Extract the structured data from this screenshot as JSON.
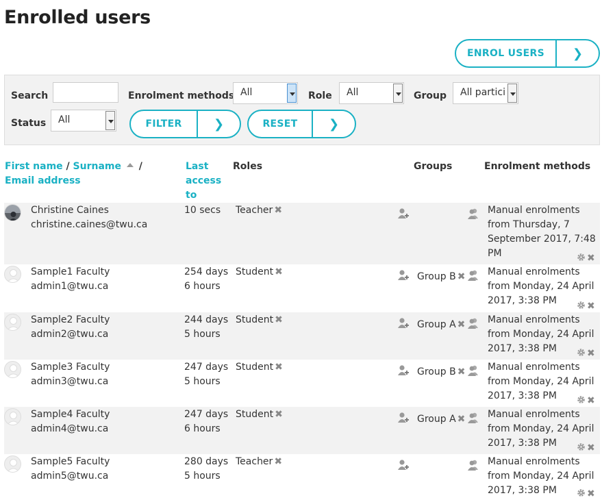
{
  "page": {
    "title": "Enrolled users"
  },
  "actions": {
    "enrol_users": "ENROL USERS"
  },
  "filters": {
    "search_label": "Search",
    "search_value": "",
    "enrolment_methods_label": "Enrolment methods",
    "enrolment_methods_value": "All",
    "role_label": "Role",
    "role_value": "All",
    "group_label": "Group",
    "group_value": "All partici",
    "status_label": "Status",
    "status_value": "All",
    "filter_button": "FILTER",
    "reset_button": "RESET"
  },
  "table": {
    "headers": {
      "first_name": "First name",
      "sep1": " / ",
      "surname": "Surname",
      "sep2": " / ",
      "email": "Email address",
      "last_access": "Last access to course",
      "roles": "Roles",
      "groups": "Groups",
      "enrolment_methods": "Enrolment methods"
    },
    "rows": [
      {
        "name": "Christine Caines",
        "email": "christine.caines@twu.ca",
        "access1": "10 secs",
        "access2": "",
        "role": "Teacher",
        "group": "",
        "enrol1": "Manual enrolments",
        "enrol2": "from Thursday, 7",
        "enrol3": "September 2017, 7:48",
        "enrol4": "PM"
      },
      {
        "name": "Sample1 Faculty",
        "email": "admin1@twu.ca",
        "access1": "254 days",
        "access2": "6 hours",
        "role": "Student",
        "group": "Group B",
        "enrol1": "Manual enrolments",
        "enrol2": "from Monday, 24 April",
        "enrol3": "2017, 3:38 PM",
        "enrol4": ""
      },
      {
        "name": "Sample2 Faculty",
        "email": "admin2@twu.ca",
        "access1": "244 days",
        "access2": "5 hours",
        "role": "Student",
        "group": "Group A",
        "enrol1": "Manual enrolments",
        "enrol2": "from Monday, 24 April",
        "enrol3": "2017, 3:38 PM",
        "enrol4": ""
      },
      {
        "name": "Sample3 Faculty",
        "email": "admin3@twu.ca",
        "access1": "247 days",
        "access2": "5 hours",
        "role": "Student",
        "group": "Group B",
        "enrol1": "Manual enrolments",
        "enrol2": "from Monday, 24 April",
        "enrol3": "2017, 3:38 PM",
        "enrol4": ""
      },
      {
        "name": "Sample4 Faculty",
        "email": "admin4@twu.ca",
        "access1": "247 days",
        "access2": "6 hours",
        "role": "Student",
        "group": "Group A",
        "enrol1": "Manual enrolments",
        "enrol2": "from Monday, 24 April",
        "enrol3": "2017, 3:38 PM",
        "enrol4": ""
      },
      {
        "name": "Sample5 Faculty",
        "email": "admin5@twu.ca",
        "access1": "280 days",
        "access2": "5 hours",
        "role": "Teacher",
        "group": "",
        "enrol1": "Manual enrolments",
        "enrol2": "from Monday, 24 April",
        "enrol3": "2017, 3:38 PM",
        "enrol4": ""
      }
    ]
  },
  "icons": {
    "remove": "close-icon",
    "add_role": "add-user-icon",
    "groups": "users-icon",
    "edit": "gear-icon"
  },
  "colors": {
    "accent": "#1ab1c4",
    "row_alt": "#f2f2f2"
  }
}
